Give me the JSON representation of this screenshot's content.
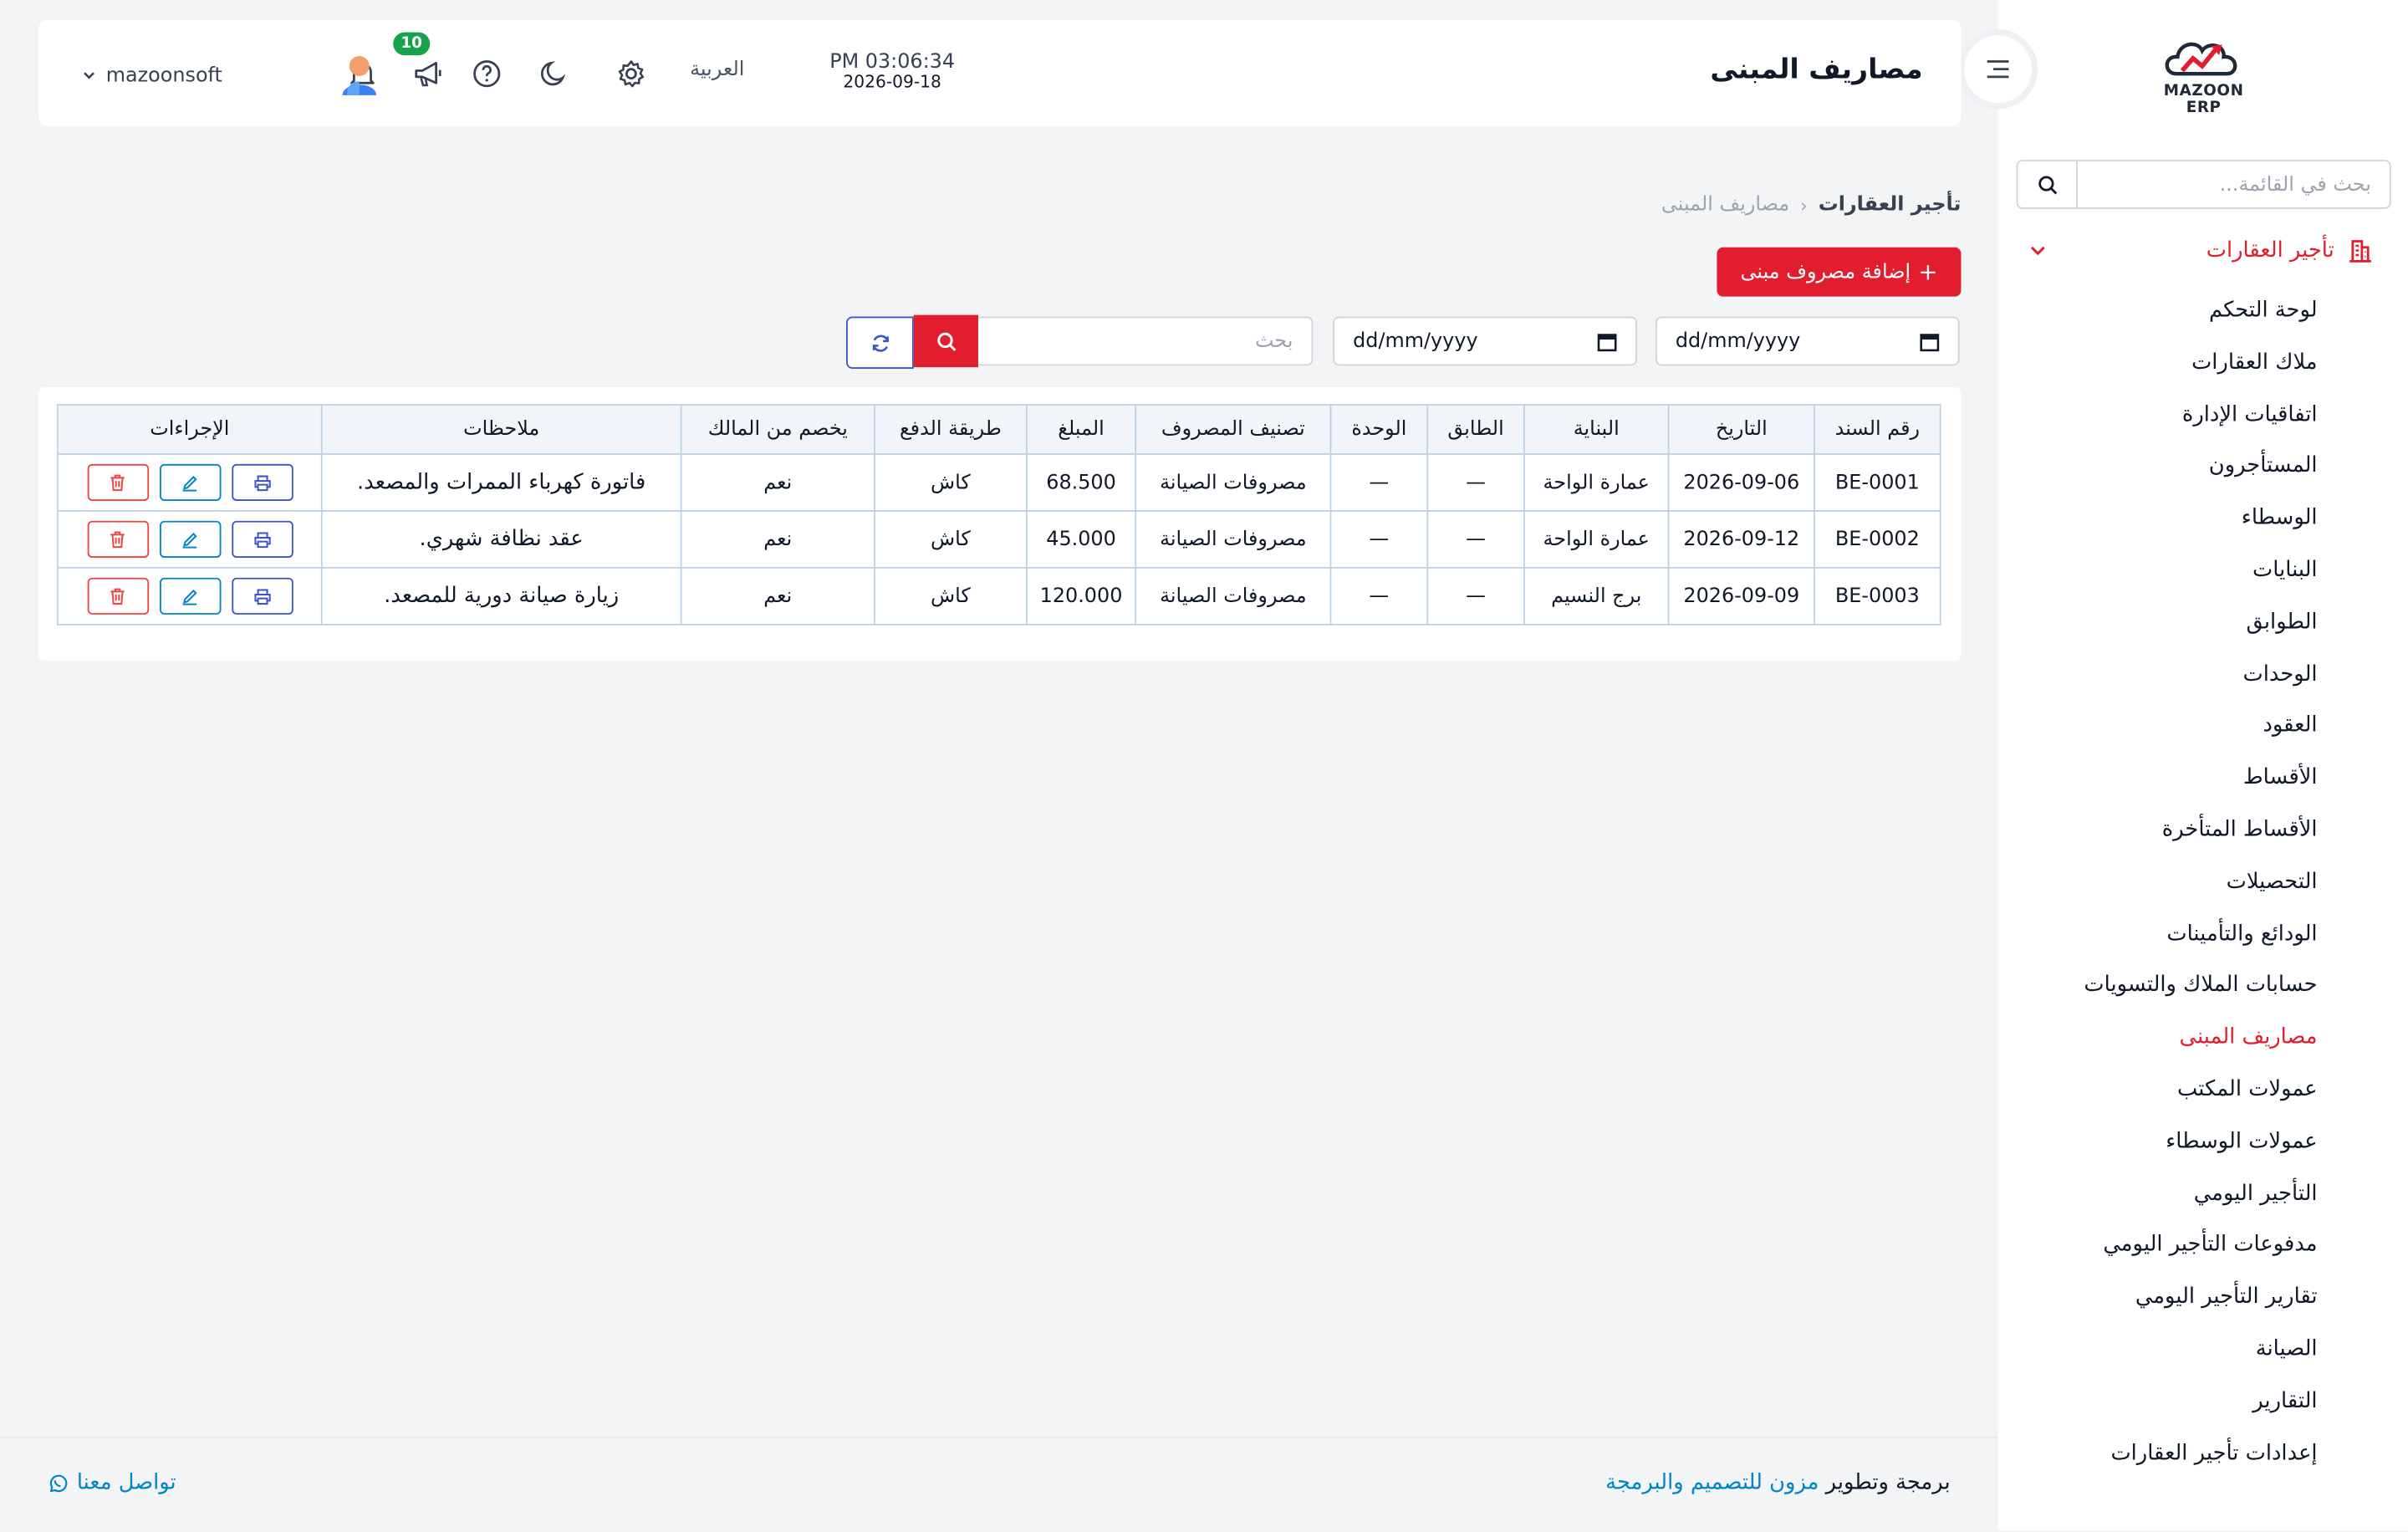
{
  "brand": {
    "name": "MAZOON ERP"
  },
  "sidebar": {
    "search_placeholder": "بحث في القائمة...",
    "section_label": "تأجير العقارات",
    "items": [
      {
        "label": "لوحة التحكم"
      },
      {
        "label": "ملاك العقارات"
      },
      {
        "label": "اتفاقيات الإدارة"
      },
      {
        "label": "المستأجرون"
      },
      {
        "label": "الوسطاء"
      },
      {
        "label": "البنايات"
      },
      {
        "label": "الطوابق"
      },
      {
        "label": "الوحدات"
      },
      {
        "label": "العقود"
      },
      {
        "label": "الأقساط"
      },
      {
        "label": "الأقساط المتأخرة"
      },
      {
        "label": "التحصيلات"
      },
      {
        "label": "الودائع والتأمينات"
      },
      {
        "label": "حسابات الملاك والتسويات"
      },
      {
        "label": "مصاريف المبنى",
        "active": true
      },
      {
        "label": "عمولات المكتب"
      },
      {
        "label": "عمولات الوسطاء"
      },
      {
        "label": "التأجير اليومي"
      },
      {
        "label": "مدفوعات التأجير اليومي"
      },
      {
        "label": "تقارير التأجير اليومي"
      },
      {
        "label": "الصيانة"
      },
      {
        "label": "التقارير"
      },
      {
        "label": "إعدادات تأجير العقارات"
      }
    ]
  },
  "header": {
    "title": "مصاريف المبنى",
    "time": "PM 03:06:34",
    "date": "2026-09-18",
    "language": "العربية",
    "notification_badge": "10",
    "username": "mazoonsoft"
  },
  "breadcrumb": {
    "root": "تأجير العقارات",
    "current": "مصاريف المبنى"
  },
  "toolbar": {
    "add_label": "إضافة مصروف مبنى"
  },
  "filters": {
    "date_from": "dd/mm/yyyy",
    "date_to": "dd/mm/yyyy",
    "search_placeholder": "بحث"
  },
  "table": {
    "columns": [
      "رقم السند",
      "التاريخ",
      "البناية",
      "الطابق",
      "الوحدة",
      "تصنيف المصروف",
      "المبلغ",
      "طريقة الدفع",
      "يخصم من المالك",
      "ملاحظات",
      "الإجراءات"
    ],
    "rows": [
      {
        "voucher": "BE-0001",
        "date": "2026-09-06",
        "building": "عمارة الواحة",
        "floor": "—",
        "unit": "—",
        "category": "مصروفات الصيانة",
        "amount": "68.500",
        "payment": "كاش",
        "deduct": "نعم",
        "notes": "فاتورة كهرباء الممرات والمصعد."
      },
      {
        "voucher": "BE-0002",
        "date": "2026-09-12",
        "building": "عمارة الواحة",
        "floor": "—",
        "unit": "—",
        "category": "مصروفات الصيانة",
        "amount": "45.000",
        "payment": "كاش",
        "deduct": "نعم",
        "notes": "عقد نظافة شهري."
      },
      {
        "voucher": "BE-0003",
        "date": "2026-09-09",
        "building": "برج النسيم",
        "floor": "—",
        "unit": "—",
        "category": "مصروفات الصيانة",
        "amount": "120.000",
        "payment": "كاش",
        "deduct": "نعم",
        "notes": "زيارة صيانة دورية للمصعد."
      }
    ]
  },
  "footer": {
    "credit_prefix": "برمجة وتطوير",
    "credit_link": "مزون للتصميم والبرمجة",
    "contact": "تواصل معنا"
  },
  "colors": {
    "accent": "#e11d2e",
    "link": "#0284c7",
    "primary_outline": "#3b55c8",
    "badge": "#16a34a"
  },
  "icons": [
    "search-icon",
    "building-icon",
    "chevron-down-icon",
    "menu-toggle-icon",
    "gear-icon",
    "moon-icon",
    "help-icon",
    "megaphone-icon",
    "bell-icon",
    "avatar",
    "calendar-icon",
    "refresh-icon",
    "print-icon",
    "edit-icon",
    "trash-icon",
    "whatsapp-icon"
  ]
}
